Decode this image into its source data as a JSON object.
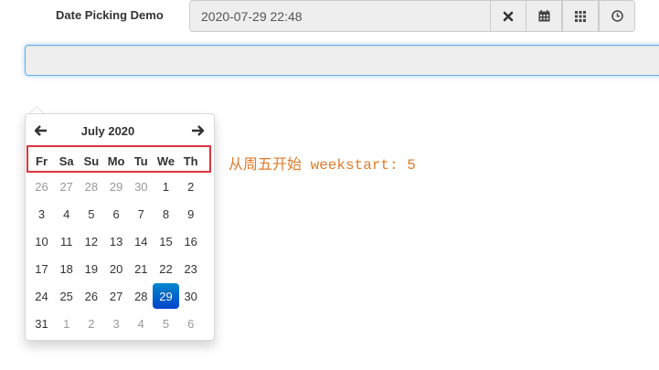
{
  "form": {
    "label": "Date Picking Demo",
    "value": "2020-07-29 22:48"
  },
  "addons": [
    {
      "icon": "close-icon"
    },
    {
      "icon": "calendar-icon"
    },
    {
      "icon": "grid-icon"
    },
    {
      "icon": "clock-icon"
    }
  ],
  "datepicker": {
    "month_title": "July 2020",
    "weekdays": [
      "Fr",
      "Sa",
      "Su",
      "Mo",
      "Tu",
      "We",
      "Th"
    ],
    "weeks": [
      [
        {
          "d": "26",
          "muted": true
        },
        {
          "d": "27",
          "muted": true
        },
        {
          "d": "28",
          "muted": true
        },
        {
          "d": "29",
          "muted": true
        },
        {
          "d": "30",
          "muted": true
        },
        {
          "d": "1"
        },
        {
          "d": "2"
        }
      ],
      [
        {
          "d": "3"
        },
        {
          "d": "4"
        },
        {
          "d": "5"
        },
        {
          "d": "6"
        },
        {
          "d": "7"
        },
        {
          "d": "8"
        },
        {
          "d": "9"
        }
      ],
      [
        {
          "d": "10"
        },
        {
          "d": "11"
        },
        {
          "d": "12"
        },
        {
          "d": "13"
        },
        {
          "d": "14"
        },
        {
          "d": "15"
        },
        {
          "d": "16"
        }
      ],
      [
        {
          "d": "17"
        },
        {
          "d": "18"
        },
        {
          "d": "19"
        },
        {
          "d": "20"
        },
        {
          "d": "21"
        },
        {
          "d": "22"
        },
        {
          "d": "23"
        }
      ],
      [
        {
          "d": "24"
        },
        {
          "d": "25"
        },
        {
          "d": "26"
        },
        {
          "d": "27"
        },
        {
          "d": "28"
        },
        {
          "d": "29",
          "active": true
        },
        {
          "d": "30"
        }
      ],
      [
        {
          "d": "31"
        },
        {
          "d": "1",
          "muted": true
        },
        {
          "d": "2",
          "muted": true
        },
        {
          "d": "3",
          "muted": true
        },
        {
          "d": "4",
          "muted": true
        },
        {
          "d": "5",
          "muted": true
        },
        {
          "d": "6",
          "muted": true
        }
      ]
    ],
    "highlight_color": "#d9363e",
    "active_color": "#0066cc"
  },
  "annotation": {
    "text": "从周五开始 weekstart: 5",
    "color": "#e07b2a"
  }
}
